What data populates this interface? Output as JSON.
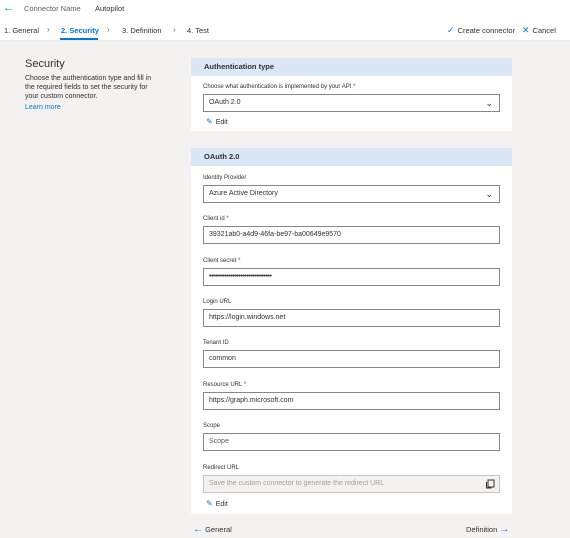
{
  "header": {
    "back_icon": "arrow-left-icon",
    "connector_name_label": "Connector Name",
    "connector_name_value": "Autopilot"
  },
  "steps": [
    {
      "label": "1. General",
      "active": false
    },
    {
      "label": "2. Security",
      "active": true
    },
    {
      "label": "3. Definition",
      "active": false
    },
    {
      "label": "4. Test",
      "active": false
    }
  ],
  "actions": {
    "create_label": "Create connector",
    "create_icon": "checkmark-icon",
    "cancel_label": "Cancel",
    "cancel_icon": "close-icon"
  },
  "sidebar": {
    "title": "Security",
    "description": "Choose the authentication type and fill in the required fields to set the security for your custom connector.",
    "link": "Learn more"
  },
  "auth_card": {
    "header": "Authentication type",
    "question_label": "Choose what authentication is implemented by your API",
    "selected": "OAuth 2.0",
    "edit_label": "Edit"
  },
  "oauth_card": {
    "header": "OAuth 2.0",
    "identity_provider_label": "Identity Provider",
    "identity_provider_value": "Azure Active Directory",
    "client_id_label": "Client id",
    "client_id_value": "39321ab0-a4d9-46fa-be97-ba00649e9570",
    "client_secret_label": "Client secret",
    "client_secret_value": "••••••••••••••••••••••••••••••••",
    "login_url_label": "Login URL",
    "login_url_value": "https://login.windows.net",
    "tenant_id_label": "Tenant ID",
    "tenant_id_value": "common",
    "resource_url_label": "Resource URL",
    "resource_url_value": "https://graph.microsoft.com",
    "scope_label": "Scope",
    "scope_placeholder": "Scope",
    "redirect_url_label": "Redirect URL",
    "redirect_url_placeholder": "Save the custom connector to generate the redirect URL",
    "edit_label": "Edit"
  },
  "footer": {
    "prev_label": "General",
    "next_label": "Definition"
  },
  "colors": {
    "accent": "#0078d4",
    "card_header_bg": "#dbe6f6",
    "required": "#a4262c",
    "page_bg": "#f3f2f1"
  }
}
